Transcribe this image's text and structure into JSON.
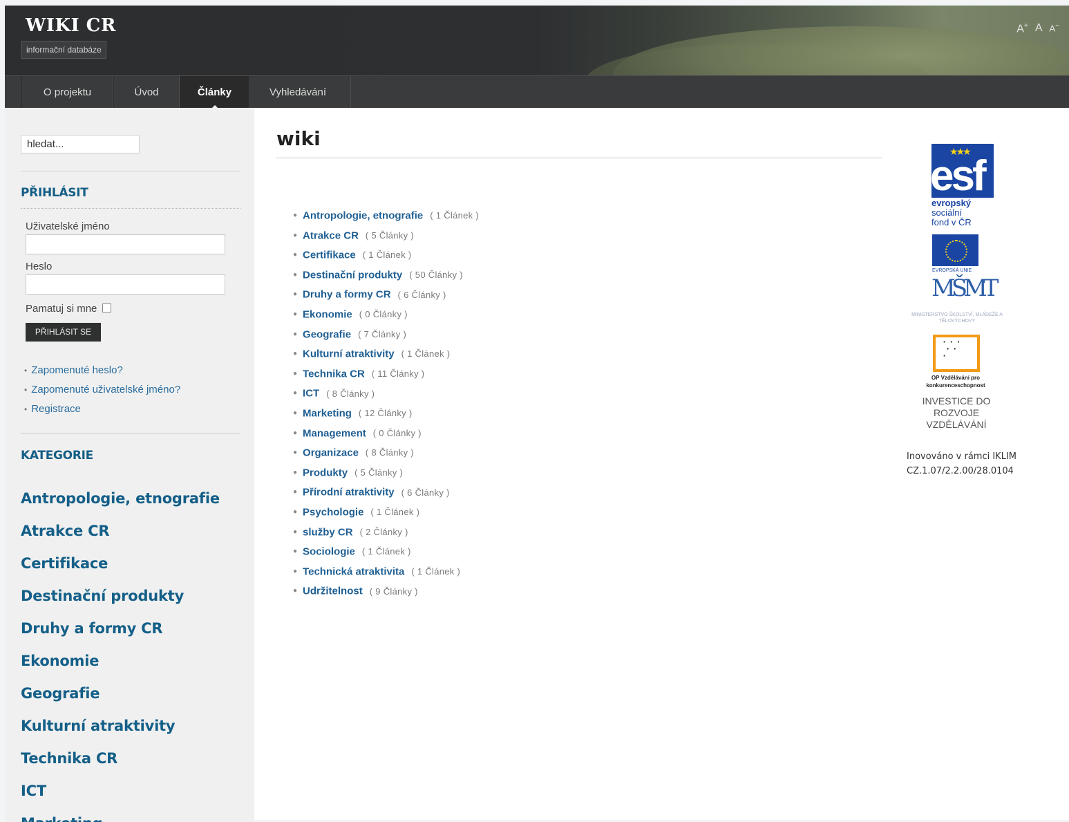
{
  "header": {
    "title": "WIKI CR",
    "subtitle": "informační databáze",
    "font_tools": {
      "increase": "A",
      "reset": "A",
      "decrease": "A"
    }
  },
  "nav": {
    "items": [
      {
        "label": "O projektu",
        "active": false
      },
      {
        "label": "Úvod",
        "active": false
      },
      {
        "label": "Články",
        "active": true
      },
      {
        "label": "Vyhledávání",
        "active": false
      }
    ]
  },
  "sidebar": {
    "search": {
      "value": "hledat..."
    },
    "login": {
      "heading": "PŘIHLÁSIT",
      "username_label": "Uživatelské jméno",
      "password_label": "Heslo",
      "remember_label": "Pamatuj si mne",
      "button_label": "PŘIHLÁSIT SE",
      "links": [
        "Zapomenuté heslo?",
        "Zapomenuté uživatelské jméno?",
        "Registrace"
      ]
    },
    "categories": {
      "heading": "KATEGORIE",
      "items": [
        "Antropologie, etnografie",
        "Atrakce CR",
        "Certifikace",
        "Destinační produkty",
        "Druhy a formy CR",
        "Ekonomie",
        "Geografie",
        "Kulturní atraktivity",
        "Technika CR",
        "ICT",
        "Marketing"
      ]
    }
  },
  "main": {
    "title": "wiki",
    "articles": [
      {
        "name": "Antropologie, etnografie",
        "count": "( 1 Článek )"
      },
      {
        "name": "Atrakce CR",
        "count": "( 5 Články )"
      },
      {
        "name": "Certifikace",
        "count": "( 1 Článek )"
      },
      {
        "name": "Destinační produkty",
        "count": "( 50 Články )"
      },
      {
        "name": "Druhy a formy CR",
        "count": "( 6 Články )"
      },
      {
        "name": "Ekonomie",
        "count": "( 0 Články )"
      },
      {
        "name": "Geografie",
        "count": "( 7 Články )"
      },
      {
        "name": "Kulturní atraktivity",
        "count": "( 1 Článek )"
      },
      {
        "name": "Technika CR",
        "count": "( 11 Články )"
      },
      {
        "name": "ICT",
        "count": "( 8 Články )"
      },
      {
        "name": "Marketing",
        "count": "( 12 Články )"
      },
      {
        "name": "Management",
        "count": "( 0 Články )"
      },
      {
        "name": "Organizace",
        "count": "( 8 Články )"
      },
      {
        "name": "Produkty",
        "count": "( 5 Články )"
      },
      {
        "name": "Přírodní atraktivity",
        "count": "( 6 Články )"
      },
      {
        "name": "Psychologie",
        "count": "( 1 Článek )"
      },
      {
        "name": "služby CR",
        "count": "( 2 Články )"
      },
      {
        "name": "Sociologie",
        "count": "( 1 Článek )"
      },
      {
        "name": "Technická atraktivita",
        "count": "( 1 Článek )"
      },
      {
        "name": "Udržitelnost",
        "count": "( 9 Články )"
      }
    ]
  },
  "logos": {
    "esf": {
      "mark": "esf",
      "line1": "evropský",
      "line2": "sociální",
      "line3": "fond v ČR"
    },
    "eu_caption": "EVROPSKÁ UNIE",
    "msmt": {
      "mark": "MŠMT",
      "caption": "MINISTERSTVO ŠKOLSTVÍ, MLÁDEŽE A TĚLOVÝCHOVY"
    },
    "op_caption": "OP Vzdělávání pro konkurenceschopnost",
    "investice": "INVESTICE DO ROZVOJE VZDĚLÁVÁNÍ",
    "inov_line1": "Inovováno v rámci IKLIM",
    "inov_line2": "CZ.1.07/2.2.00/28.0104"
  }
}
